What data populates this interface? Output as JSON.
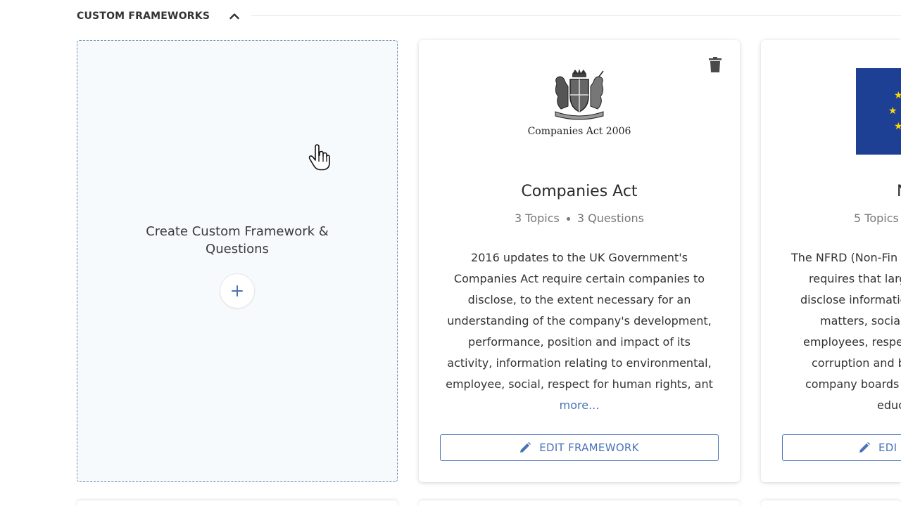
{
  "section": {
    "title": "CUSTOM FRAMEWORKS",
    "collapse_icon": "chevron-up-icon"
  },
  "create_card": {
    "label": "Create Custom Framework & Questions",
    "plus": "+"
  },
  "frameworks": [
    {
      "logo_caption": "Companies Act 2006",
      "title": "Companies Act",
      "topics": "3 Topics",
      "questions": "3 Questions",
      "description": "2016 updates to the UK Government's Companies Act require certain companies to disclose, to the extent necessary for an understanding of the company's development, performance, position and impact of its activity, information relating to environmental, employee, social, respect for human rights, ant",
      "more": "more...",
      "edit_label": "EDIT FRAMEWORK"
    },
    {
      "title": "N",
      "topics": "5 Topics",
      "description_lines": [
        "The NFRD (Non-Fin",
        "requires that larg",
        "disclose informatio",
        "matters, social m",
        "employees, respe",
        "corruption and b",
        "company boards",
        "educ"
      ],
      "edit_label": "EDI"
    }
  ],
  "colors": {
    "accent": "#4a73b8",
    "eu_blue": "#1d3f94",
    "eu_gold": "#ffd800"
  }
}
